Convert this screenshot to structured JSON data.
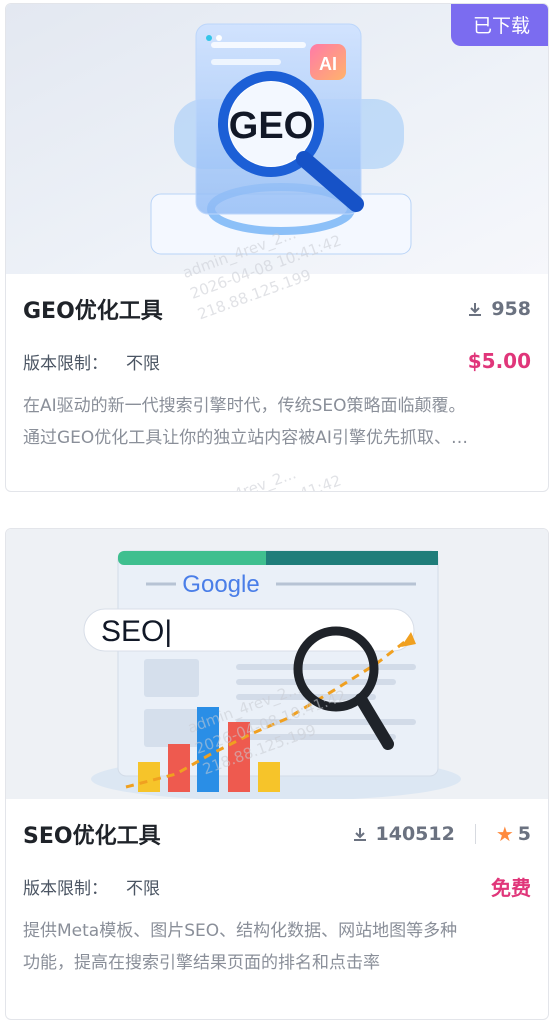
{
  "cards": [
    {
      "title": "GEO优化工具",
      "downloaded_badge": "已下载",
      "downloads": "958",
      "version_label": "版本限制：",
      "version_value": "不限",
      "price": "$5.00",
      "desc_line1": "在AI驱动的新一代搜索引擎时代，传统SEO策略面临颠覆。",
      "desc_line2": "通过GEO优化工具让你的独立站内容被AI引擎优先抓取、…",
      "thumb_text": "GEO",
      "thumb_ai": "AI"
    },
    {
      "title": "SEO优化工具",
      "downloads": "140512",
      "rating": "5",
      "version_label": "版本限制：",
      "version_value": "不限",
      "price": "免费",
      "desc_line1": "提供Meta模板、图片SEO、结构化数据、网站地图等多种",
      "desc_line2": "功能，提高在搜索引擎结果页面的排名和点击率",
      "thumb_google": "Google",
      "thumb_seo": "SEO|"
    }
  ],
  "watermark": {
    "line1": "admin_4rev_2...",
    "line2": "2026-04-08 10:41:42",
    "line3": "218.88.125.199"
  },
  "colors": {
    "badge": "#7b6cf0",
    "price": "#e0367a",
    "star": "#ff8a3d"
  }
}
